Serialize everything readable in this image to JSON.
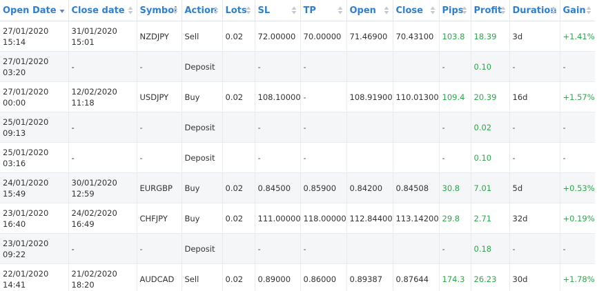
{
  "colors": {
    "header_text": "#2f7fd0",
    "positive": "#2ba84a",
    "text": "#333333",
    "alt_row": "#f4f6f8",
    "border": "#e8ebef",
    "sort_inactive": "#c5c9cf",
    "sort_active": "#6f7fb0"
  },
  "columns": [
    {
      "key": "open_date",
      "label": "Open Date",
      "sort": "desc-active"
    },
    {
      "key": "close_date",
      "label": "Close date",
      "sort": "none"
    },
    {
      "key": "symbol",
      "label": "Symbol",
      "sort": "none"
    },
    {
      "key": "action",
      "label": "Action",
      "sort": "none"
    },
    {
      "key": "lots",
      "label": "Lots",
      "sort": "none"
    },
    {
      "key": "sl",
      "label": "SL",
      "sort": "none"
    },
    {
      "key": "tp",
      "label": "TP",
      "sort": "none"
    },
    {
      "key": "open",
      "label": "Open",
      "sort": "none"
    },
    {
      "key": "close",
      "label": "Close",
      "sort": "none"
    },
    {
      "key": "pips",
      "label": "Pips",
      "sort": "none"
    },
    {
      "key": "profit",
      "label": "Profit",
      "sort": "none"
    },
    {
      "key": "duration",
      "label": "Duration",
      "sort": "none"
    },
    {
      "key": "gain",
      "label": "Gain",
      "sort": "none"
    }
  ],
  "rows": [
    {
      "open_date": [
        "27/01/2020",
        "15:14"
      ],
      "close_date": [
        "31/01/2020",
        "15:01"
      ],
      "symbol": "NZDJPY",
      "action": "Sell",
      "lots": "0.02",
      "sl": "72.00000",
      "tp": "70.00000",
      "open": "71.46900",
      "close": "70.43100",
      "pips": "103.8",
      "profit": "18.39",
      "duration": "3d",
      "gain": "+1.41%"
    },
    {
      "open_date": [
        "27/01/2020",
        "03:20"
      ],
      "close_date": [
        "-"
      ],
      "symbol": "-",
      "action": "Deposit",
      "lots": "",
      "sl": "-",
      "tp": "-",
      "open": "",
      "close": "",
      "pips": "-",
      "profit": "0.10",
      "duration": "-",
      "gain": "-"
    },
    {
      "open_date": [
        "27/01/2020",
        "00:00"
      ],
      "close_date": [
        "12/02/2020",
        "11:18"
      ],
      "symbol": "USDJPY",
      "action": "Buy",
      "lots": "0.02",
      "sl": "108.10000",
      "tp": "-",
      "open": "108.91900",
      "close": "110.01300",
      "pips": "109.4",
      "profit": "20.39",
      "duration": "16d",
      "gain": "+1.57%"
    },
    {
      "open_date": [
        "25/01/2020",
        "09:13"
      ],
      "close_date": [
        "-"
      ],
      "symbol": "-",
      "action": "Deposit",
      "lots": "",
      "sl": "-",
      "tp": "-",
      "open": "",
      "close": "",
      "pips": "-",
      "profit": "0.02",
      "duration": "-",
      "gain": "-"
    },
    {
      "open_date": [
        "25/01/2020",
        "03:16"
      ],
      "close_date": [
        "-"
      ],
      "symbol": "-",
      "action": "Deposit",
      "lots": "",
      "sl": "-",
      "tp": "-",
      "open": "",
      "close": "",
      "pips": "-",
      "profit": "0.10",
      "duration": "-",
      "gain": "-"
    },
    {
      "open_date": [
        "24/01/2020",
        "15:49"
      ],
      "close_date": [
        "30/01/2020",
        "12:59"
      ],
      "symbol": "EURGBP",
      "action": "Buy",
      "lots": "0.02",
      "sl": "0.84500",
      "tp": "0.85900",
      "open": "0.84200",
      "close": "0.84508",
      "pips": "30.8",
      "profit": "7.01",
      "duration": "5d",
      "gain": "+0.53%"
    },
    {
      "open_date": [
        "23/01/2020",
        "16:40"
      ],
      "close_date": [
        "24/02/2020",
        "16:49"
      ],
      "symbol": "CHFJPY",
      "action": "Buy",
      "lots": "0.02",
      "sl": "111.00000",
      "tp": "118.00000",
      "open": "112.84400",
      "close": "113.14200",
      "pips": "29.8",
      "profit": "2.71",
      "duration": "32d",
      "gain": "+0.19%"
    },
    {
      "open_date": [
        "23/01/2020",
        "09:22"
      ],
      "close_date": [
        "-"
      ],
      "symbol": "-",
      "action": "Deposit",
      "lots": "",
      "sl": "-",
      "tp": "-",
      "open": "",
      "close": "",
      "pips": "-",
      "profit": "0.18",
      "duration": "-",
      "gain": "-"
    },
    {
      "open_date": [
        "22/01/2020",
        "14:41"
      ],
      "close_date": [
        "21/02/2020",
        "18:20"
      ],
      "symbol": "AUDCAD",
      "action": "Sell",
      "lots": "0.02",
      "sl": "0.89000",
      "tp": "0.86000",
      "open": "0.89387",
      "close": "0.87644",
      "pips": "174.3",
      "profit": "26.23",
      "duration": "30d",
      "gain": "+1.78%"
    }
  ]
}
